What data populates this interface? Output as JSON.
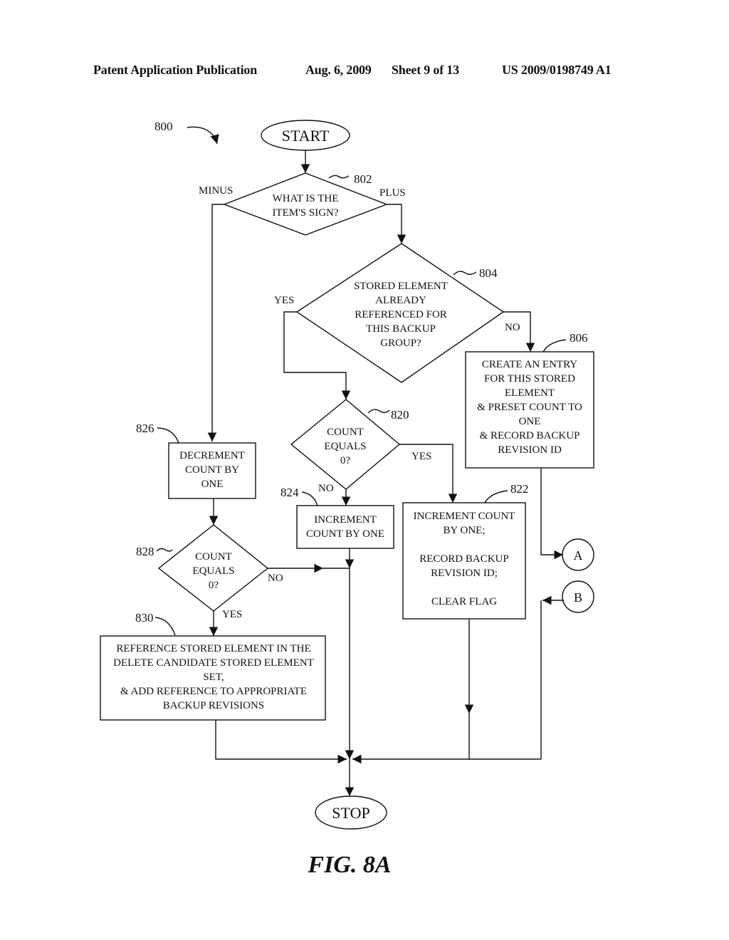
{
  "header": {
    "publication": "Patent Application Publication",
    "date": "Aug. 6, 2009",
    "sheet": "Sheet 9 of 13",
    "number": "US 2009/0198749 A1"
  },
  "figure": {
    "ref": "800",
    "caption": "FIG. 8A",
    "start": "START",
    "stop": "STOP",
    "nodes": {
      "n802": {
        "ref": "802",
        "lines": [
          "WHAT IS THE",
          "ITEM'S SIGN?"
        ],
        "minus": "MINUS",
        "plus": "PLUS"
      },
      "n804": {
        "ref": "804",
        "lines": [
          "STORED ELEMENT",
          "ALREADY",
          "REFERENCED FOR",
          "THIS BACKUP",
          "GROUP?"
        ],
        "yes": "YES",
        "no": "NO"
      },
      "n806": {
        "ref": "806",
        "lines": [
          "CREATE AN ENTRY",
          "FOR THIS STORED",
          "ELEMENT",
          "& PRESET COUNT TO",
          "ONE",
          "& RECORD BACKUP",
          "REVISION ID"
        ]
      },
      "n820": {
        "ref": "820",
        "lines": [
          "COUNT",
          "EQUALS",
          "0?"
        ],
        "yes": "YES",
        "no": "NO"
      },
      "n822": {
        "ref": "822",
        "lines": [
          "INCREMENT COUNT",
          "BY ONE;",
          "",
          "RECORD BACKUP",
          "REVISION ID;",
          "",
          "CLEAR FLAG"
        ]
      },
      "n824": {
        "ref": "824",
        "lines": [
          "INCREMENT",
          "COUNT BY ONE"
        ]
      },
      "n826": {
        "ref": "826",
        "lines": [
          "DECREMENT",
          "COUNT BY",
          "ONE"
        ]
      },
      "n828": {
        "ref": "828",
        "lines": [
          "COUNT",
          "EQUALS",
          "0?"
        ],
        "yes": "YES",
        "no": "NO"
      },
      "n830": {
        "ref": "830",
        "lines": [
          "REFERENCE STORED ELEMENT IN THE",
          "DELETE CANDIDATE STORED ELEMENT",
          "SET,",
          "& ADD REFERENCE TO APPROPRIATE",
          "BACKUP REVISIONS"
        ]
      }
    },
    "connectors": {
      "a": "A",
      "b": "B"
    }
  }
}
